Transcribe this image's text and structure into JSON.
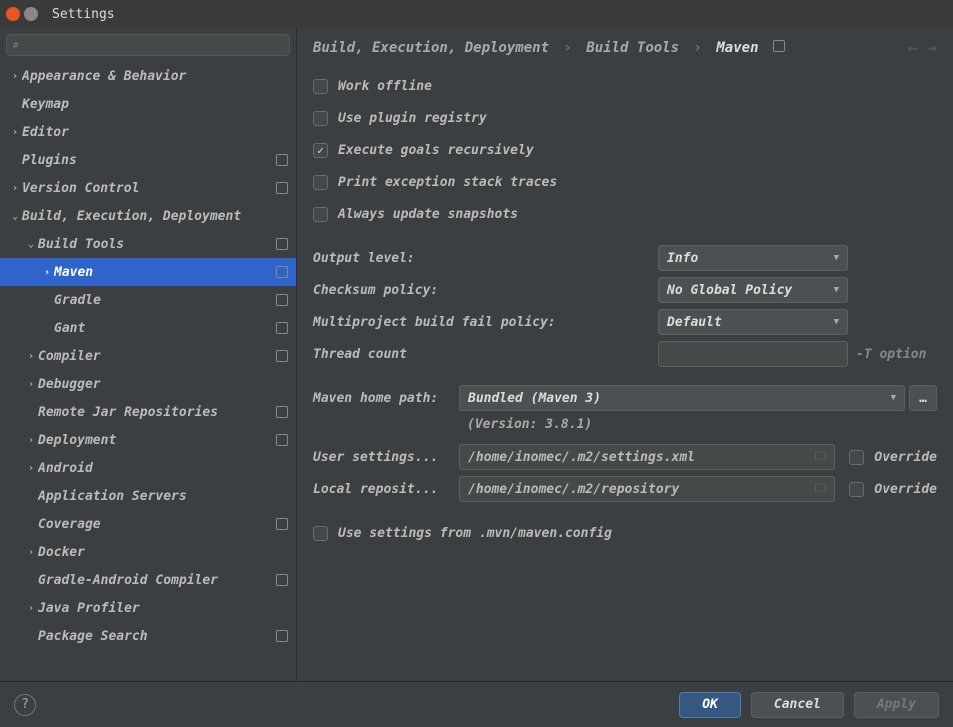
{
  "titlebar": {
    "title": "Settings"
  },
  "search": {
    "placeholder": ""
  },
  "tree": [
    {
      "label": "Appearance & Behavior",
      "indent": 0,
      "arrow": "›",
      "badge": false
    },
    {
      "label": "Keymap",
      "indent": 0,
      "arrow": "",
      "badge": false
    },
    {
      "label": "Editor",
      "indent": 0,
      "arrow": "›",
      "badge": false
    },
    {
      "label": "Plugins",
      "indent": 0,
      "arrow": "",
      "badge": true
    },
    {
      "label": "Version Control",
      "indent": 0,
      "arrow": "›",
      "badge": true
    },
    {
      "label": "Build, Execution, Deployment",
      "indent": 0,
      "arrow": "⌄",
      "badge": false
    },
    {
      "label": "Build Tools",
      "indent": 1,
      "arrow": "⌄",
      "badge": true
    },
    {
      "label": "Maven",
      "indent": 2,
      "arrow": "›",
      "badge": true,
      "selected": true
    },
    {
      "label": "Gradle",
      "indent": 2,
      "arrow": "",
      "badge": true
    },
    {
      "label": "Gant",
      "indent": 2,
      "arrow": "",
      "badge": true
    },
    {
      "label": "Compiler",
      "indent": 1,
      "arrow": "›",
      "badge": true
    },
    {
      "label": "Debugger",
      "indent": 1,
      "arrow": "›",
      "badge": false
    },
    {
      "label": "Remote Jar Repositories",
      "indent": 1,
      "arrow": "",
      "badge": true
    },
    {
      "label": "Deployment",
      "indent": 1,
      "arrow": "›",
      "badge": true
    },
    {
      "label": "Android",
      "indent": 1,
      "arrow": "›",
      "badge": false
    },
    {
      "label": "Application Servers",
      "indent": 1,
      "arrow": "",
      "badge": false
    },
    {
      "label": "Coverage",
      "indent": 1,
      "arrow": "",
      "badge": true
    },
    {
      "label": "Docker",
      "indent": 1,
      "arrow": "›",
      "badge": false
    },
    {
      "label": "Gradle-Android Compiler",
      "indent": 1,
      "arrow": "",
      "badge": true
    },
    {
      "label": "Java Profiler",
      "indent": 1,
      "arrow": "›",
      "badge": false
    },
    {
      "label": "Package Search",
      "indent": 1,
      "arrow": "",
      "badge": true
    }
  ],
  "breadcrumb": {
    "a": "Build, Execution, Deployment",
    "b": "Build Tools",
    "c": "Maven"
  },
  "checkboxes": {
    "work_offline": {
      "label": "Work offline",
      "checked": false
    },
    "plugin_registry": {
      "label": "Use plugin registry",
      "checked": false
    },
    "exec_recursive": {
      "label": "Execute goals recursively",
      "checked": true
    },
    "print_stack": {
      "label": "Print exception stack traces",
      "checked": false
    },
    "always_update": {
      "label": "Always update snapshots",
      "checked": false
    },
    "use_mvn_config": {
      "label": "Use settings from .mvn/maven.config",
      "checked": false
    },
    "override_user": {
      "label": "Override",
      "checked": false
    },
    "override_local": {
      "label": "Override",
      "checked": false
    }
  },
  "fields": {
    "output_level": {
      "label": "Output level:",
      "value": "Info"
    },
    "checksum": {
      "label": "Checksum policy:",
      "value": "No Global Policy"
    },
    "multi_fail": {
      "label": "Multiproject build fail policy:",
      "value": "Default"
    },
    "thread_count": {
      "label": "Thread count",
      "value": "",
      "hint": "-T option"
    },
    "maven_home": {
      "label": "Maven home path:",
      "value": "Bundled (Maven 3)"
    },
    "version": {
      "text": "(Version: 3.8.1)"
    },
    "user_settings": {
      "label": "User settings...",
      "value": "/home/inomec/.m2/settings.xml"
    },
    "local_repo": {
      "label": "Local reposit...",
      "value": "/home/inomec/.m2/repository"
    }
  },
  "footer": {
    "ok": "OK",
    "cancel": "Cancel",
    "apply": "Apply"
  }
}
